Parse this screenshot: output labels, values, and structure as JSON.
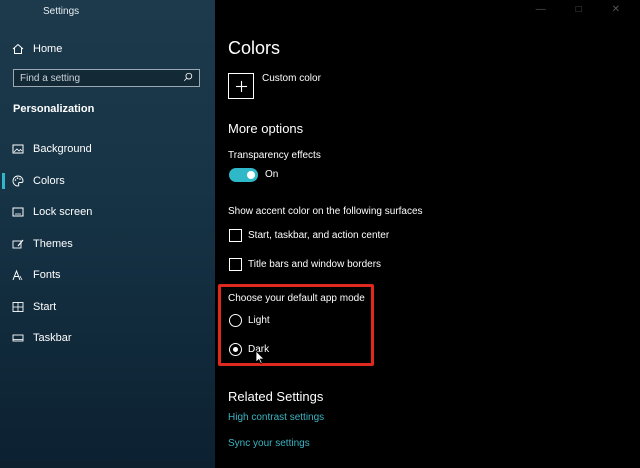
{
  "window": {
    "title": "Settings"
  },
  "sidebar": {
    "home": "Home",
    "search_placeholder": "Find a setting",
    "section": "Personalization",
    "items": [
      {
        "label": "Background",
        "icon": "image-icon"
      },
      {
        "label": "Colors",
        "icon": "palette-icon",
        "selected": true
      },
      {
        "label": "Lock screen",
        "icon": "lock-screen-icon"
      },
      {
        "label": "Themes",
        "icon": "brush-icon"
      },
      {
        "label": "Fonts",
        "icon": "font-icon"
      },
      {
        "label": "Start",
        "icon": "start-grid-icon"
      },
      {
        "label": "Taskbar",
        "icon": "taskbar-icon"
      }
    ]
  },
  "main": {
    "title": "Colors",
    "custom_color": "Custom color",
    "more_options": "More options",
    "transparency": {
      "label": "Transparency effects",
      "state": "On"
    },
    "accent_surfaces": {
      "label": "Show accent color on the following surfaces",
      "options": [
        "Start, taskbar, and action center",
        "Title bars and window borders"
      ]
    },
    "app_mode": {
      "label": "Choose your default app mode",
      "options": [
        "Light",
        "Dark"
      ],
      "selected": "Dark"
    },
    "related": {
      "title": "Related Settings",
      "links": [
        "High contrast settings",
        "Sync your settings"
      ]
    }
  },
  "colors": {
    "accent": "#2fb8c7",
    "highlight": "#e0291e",
    "link": "#3bb4c4"
  }
}
